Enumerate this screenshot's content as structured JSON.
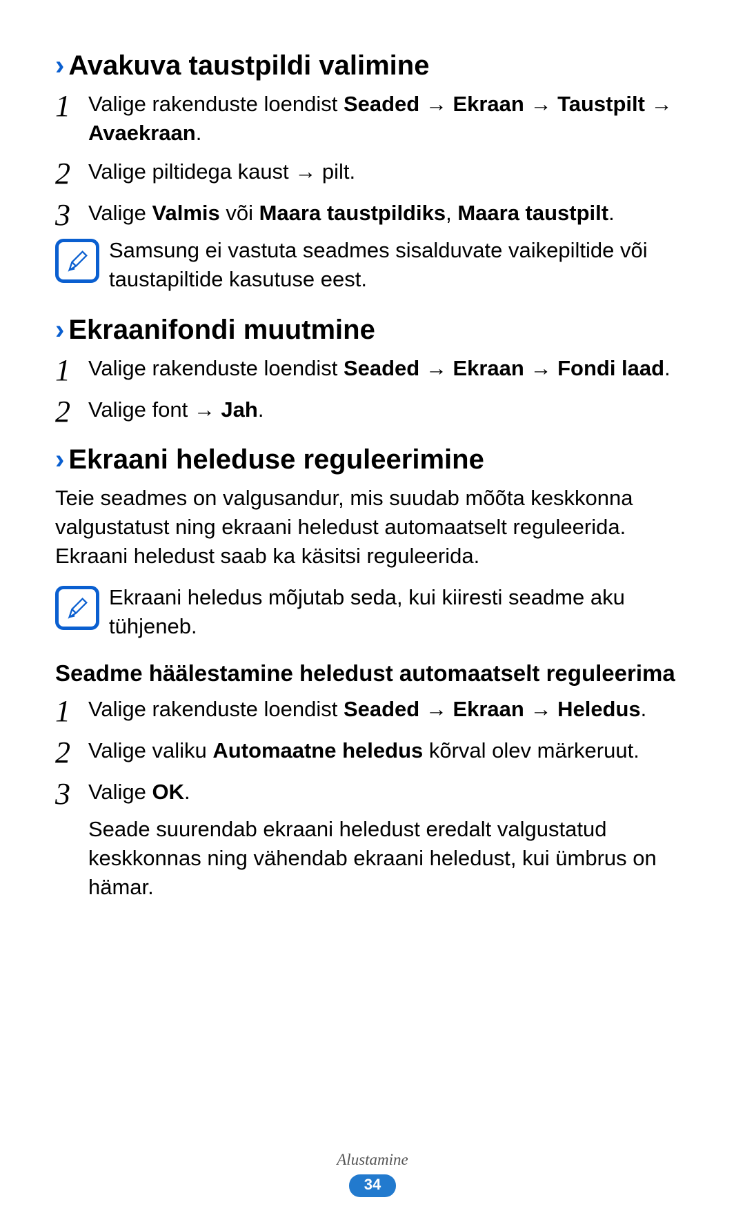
{
  "chevron": "›",
  "section1": {
    "heading": "Avakuva taustpildi valimine",
    "step1_prefix": "Valige rakenduste loendist ",
    "step1_bold": "Seaded → Ekraan → Taustpilt → Avaekraan",
    "step1_suffix": ".",
    "step2": "Valige piltidega kaust → pilt.",
    "step3_prefix": "Valige ",
    "step3_b1": "Valmis",
    "step3_mid1": " või ",
    "step3_b2": "Maara taustpildiks",
    "step3_mid2": ", ",
    "step3_b3": "Maara taustpilt",
    "step3_suffix": ".",
    "note": "Samsung ei vastuta seadmes sisalduvate vaikepiltide või taustapiltide kasutuse eest."
  },
  "section2": {
    "heading": "Ekraanifondi muutmine",
    "step1_prefix": "Valige rakenduste loendist ",
    "step1_bold": "Seaded → Ekraan → Fondi laad",
    "step1_suffix": ".",
    "step2_prefix": "Valige font → ",
    "step2_bold": "Jah",
    "step2_suffix": "."
  },
  "section3": {
    "heading": "Ekraani heleduse reguleerimine",
    "paragraph": "Teie seadmes on valgusandur, mis suudab mõõta keskkonna valgustatust ning ekraani heledust automaatselt reguleerida. Ekraani heledust saab ka käsitsi reguleerida.",
    "note": "Ekraani heledus mõjutab seda, kui kiiresti seadme aku tühjeneb.",
    "subheading": "Seadme häälestamine heledust automaatselt reguleerima",
    "step1_prefix": "Valige rakenduste loendist ",
    "step1_bold": "Seaded → Ekraan → Heledus",
    "step1_suffix": ".",
    "step2_prefix": "Valige valiku ",
    "step2_bold": "Automaatne heledus",
    "step2_suffix": " kõrval olev märkeruut.",
    "step3_prefix": "Valige ",
    "step3_bold": "OK",
    "step3_suffix": ".",
    "step3_followup": "Seade suurendab ekraani heledust eredalt valgustatud keskkonnas ning vähendab ekraani heledust, kui ümbrus on hämar."
  },
  "numbers": {
    "n1": "1",
    "n2": "2",
    "n3": "3"
  },
  "footer": {
    "label": "Alustamine",
    "page": "34"
  }
}
